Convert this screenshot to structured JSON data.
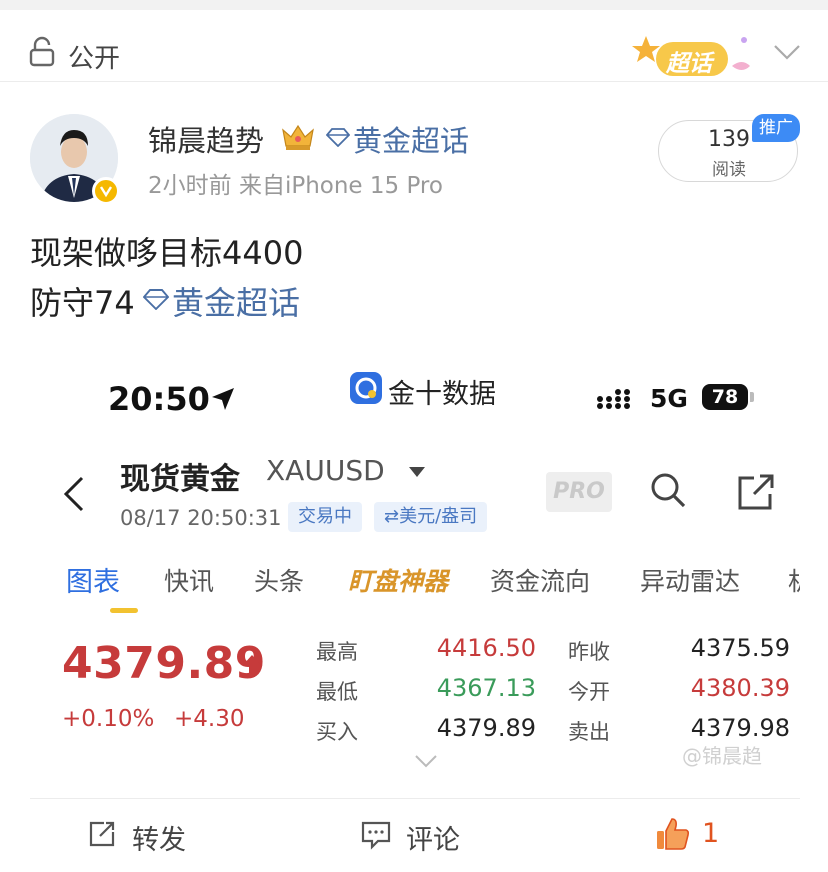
{
  "visibility": {
    "label": "公开",
    "icon": "lock-icon"
  },
  "badge": {
    "text": "超话",
    "colors": {
      "bg": "#f7c84a",
      "text": "#ffffff"
    }
  },
  "author": {
    "name": "锦晨趋势",
    "topic": "黄金超话",
    "meta": "2小时前  来自iPhone 15 Pro",
    "verified": true
  },
  "reads": {
    "count": "139",
    "label": "阅读",
    "promo": "推广"
  },
  "post": {
    "line1": "现架做哆目标4400",
    "line2_prefix": "防守74",
    "line2_topic": "黄金超话"
  },
  "screenshot": {
    "status": {
      "time": "20:50",
      "app": "金十数据",
      "network": "5G",
      "battery": "78"
    },
    "header": {
      "name": "现货黄金",
      "code": "XAUUSD",
      "timestamp": "08/17 20:50:31",
      "state": "交易中",
      "currency": "⇄美元/盎司",
      "pro": "PRO"
    },
    "tabs": [
      "图表",
      "快讯",
      "头条",
      "盯盘神器",
      "资金流向",
      "异动雷达",
      "机"
    ],
    "quote": {
      "price": "4379.89",
      "change_pct": "+0.10%",
      "change_abs": "+4.30"
    },
    "stats": {
      "high_label": "最高",
      "high": "4416.50",
      "prev_label": "昨收",
      "prev": "4375.59",
      "low_label": "最低",
      "low": "4367.13",
      "open_label": "今开",
      "open": "4380.39",
      "bid_label": "买入",
      "bid": "4379.89",
      "ask_label": "卖出",
      "ask": "4379.98"
    },
    "colors": {
      "up": "#c63b3b",
      "down": "#3a9b5a",
      "accent": "#2f6fe0"
    }
  },
  "watermark": "@锦晨趋",
  "actions": {
    "repost": "转发",
    "comment": "评论",
    "like_count": "1"
  }
}
